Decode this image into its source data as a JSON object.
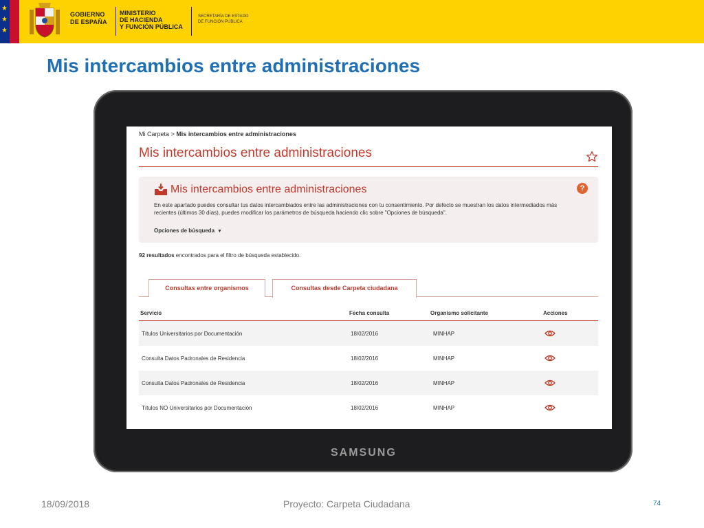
{
  "header": {
    "gov_line1": "GOBIERNO",
    "gov_line2": "DE ESPAÑA",
    "ministry_line1": "MINISTERIO",
    "ministry_line2": "DE HACIENDA",
    "ministry_line3": "Y FUNCIÓN PÚBLICA",
    "secretariat_line1": "SECRETARÍA DE ESTADO",
    "secretariat_line2": "DE FUNCIÓN PÚBLICA",
    "band_color": "#fed200"
  },
  "slide_title": "Mis intercambios entre administraciones",
  "tablet": {
    "brand": "SAMSUNG"
  },
  "screen": {
    "breadcrumb_root": "Mi Carpeta",
    "breadcrumb_sep": ">",
    "breadcrumb_current": "Mis intercambios entre administraciones",
    "page_heading": "Mis intercambios entre administraciones",
    "info": {
      "title": "Mis intercambios entre administraciones",
      "help_label": "?",
      "text": "En este apartado puedes consultar tus datos intercambiados entre las administraciones con tu consentimiento. Por defecto se muestran los datos intermediados más recientes (últimos 30 días), puedes modificar los parámetros de búsqueda haciendo clic sobre \"Opciones de búsqueda\".",
      "options_label": "Opciones de búsqueda",
      "options_caret": "▼"
    },
    "results_count": "92 resultados",
    "results_text": " encontrados para el filtro de búsqueda establecido.",
    "tabs": [
      {
        "label": "Consultas entre organismos"
      },
      {
        "label": "Consultas desde Carpeta ciudadana"
      }
    ],
    "table": {
      "columns": [
        "Servicio",
        "Fecha consulta",
        "Organismo solicitante",
        "Acciones"
      ],
      "rows": [
        {
          "servicio": "Títulos Universitarios por Documentación",
          "fecha": "18/02/2016",
          "organismo": "MINHAP"
        },
        {
          "servicio": "Consulta Datos Padronales de Residencia",
          "fecha": "18/02/2016",
          "organismo": "MINHAP"
        },
        {
          "servicio": "Consulta Datos Padronales de Residencia",
          "fecha": "18/02/2016",
          "organismo": "MINHAP"
        },
        {
          "servicio": "Títulos NO Universitarios por Documentación",
          "fecha": "18/02/2016",
          "organismo": "MINHAP"
        }
      ]
    },
    "accent_color": "#c0392b"
  },
  "footer": {
    "date": "18/09/2018",
    "project": "Proyecto: Carpeta Ciudadana",
    "page_number": "74"
  }
}
